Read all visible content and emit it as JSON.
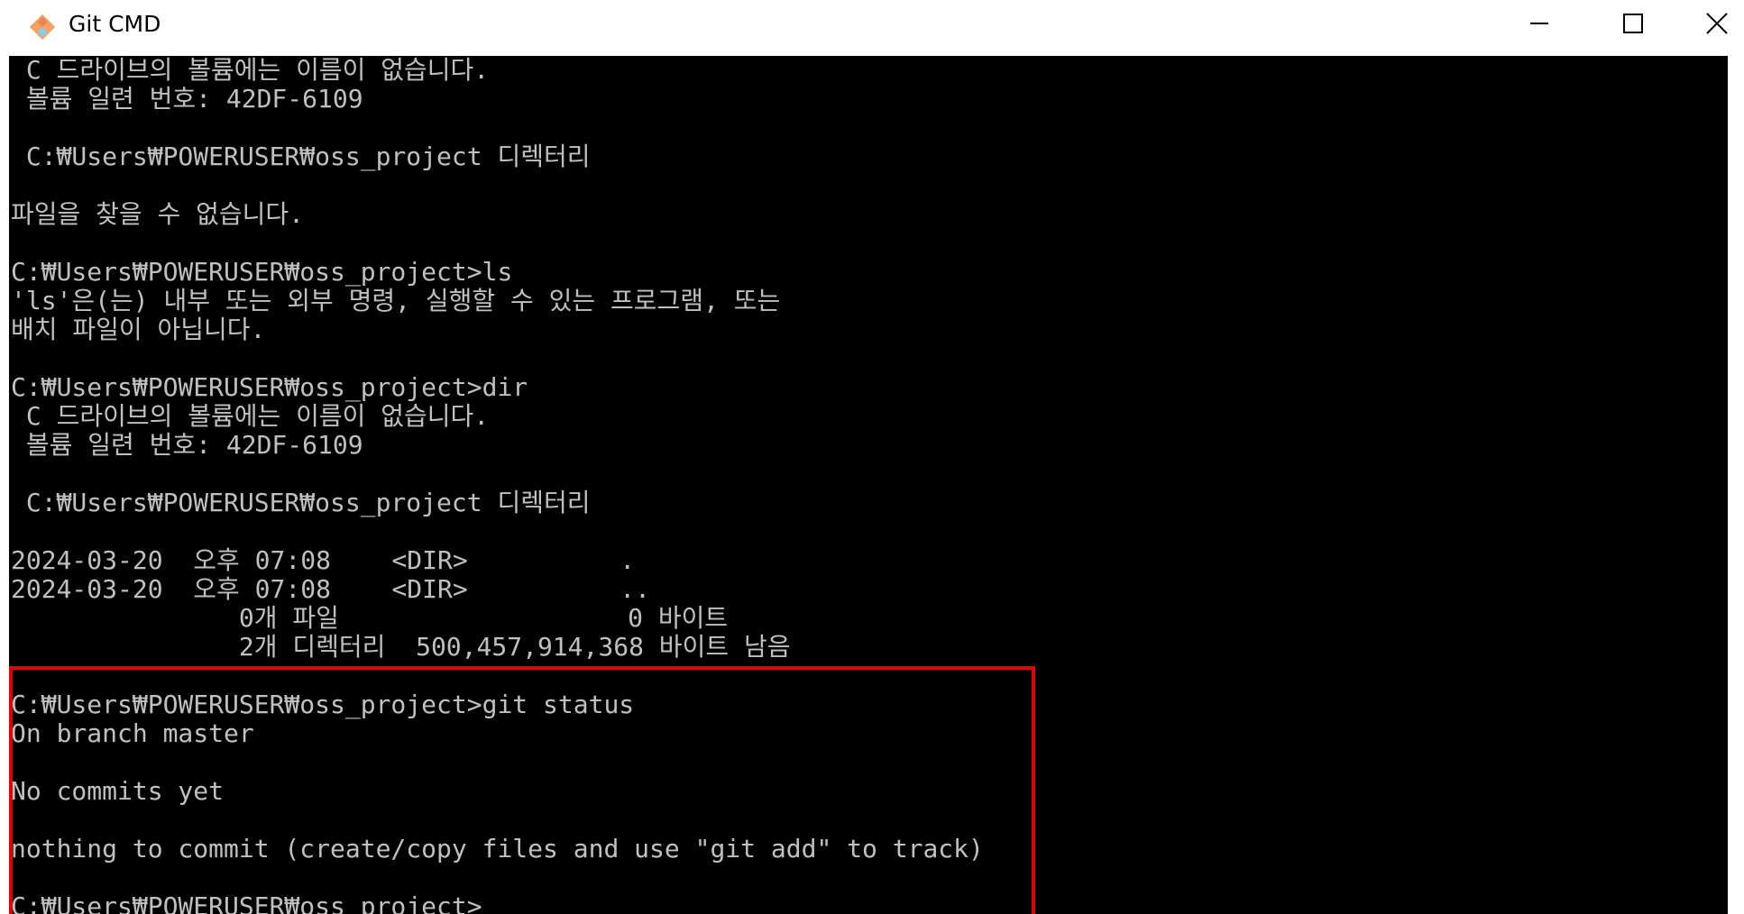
{
  "window": {
    "title": "Git CMD",
    "app_icon": "git-icon",
    "controls": {
      "minimize_icon": "minimize-icon",
      "maximize_icon": "maximize-icon",
      "close_icon": "close-icon"
    }
  },
  "console": {
    "lines": [
      " C 드라이브의 볼륨에는 이름이 없습니다.",
      " 볼륨 일련 번호: 42DF-6109",
      "",
      " C:₩Users₩POWERUSER₩oss_project 디렉터리",
      "",
      "파일을 찾을 수 없습니다.",
      "",
      "C:₩Users₩POWERUSER₩oss_project>ls",
      "'ls'은(는) 내부 또는 외부 명령, 실행할 수 있는 프로그램, 또는",
      "배치 파일이 아닙니다.",
      "",
      "C:₩Users₩POWERUSER₩oss_project>dir",
      " C 드라이브의 볼륨에는 이름이 없습니다.",
      " 볼륨 일련 번호: 42DF-6109",
      "",
      " C:₩Users₩POWERUSER₩oss_project 디렉터리",
      "",
      "2024-03-20  오후 07:08    <DIR>          .",
      "2024-03-20  오후 07:08    <DIR>          ..",
      "               0개 파일                   0 바이트",
      "               2개 디렉터리  500,457,914,368 바이트 남음",
      "",
      "C:₩Users₩POWERUSER₩oss_project>git status",
      "On branch master",
      "",
      "No commits yet",
      "",
      "nothing to commit (create/copy files and use \"git add\" to track)",
      "",
      "C:₩Users₩POWERUSER₩oss_project>"
    ],
    "colors": {
      "background": "#000000",
      "text": "#c0c0c0",
      "highlight_border": "#e00000"
    }
  }
}
